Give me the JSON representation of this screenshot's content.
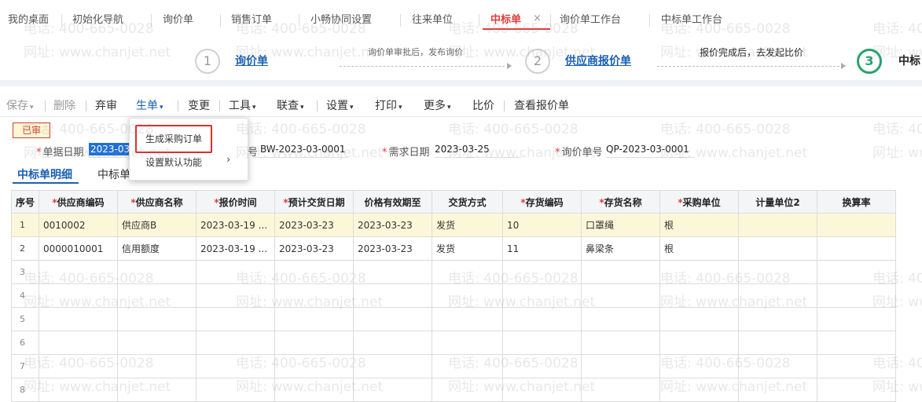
{
  "tabs": [
    {
      "label": "我的桌面"
    },
    {
      "label": "初始化导航"
    },
    {
      "label": "询价单"
    },
    {
      "label": "销售订单"
    },
    {
      "label": "小畅协同设置"
    },
    {
      "label": "往来单位"
    },
    {
      "label": "中标单"
    },
    {
      "label": "询价单工作台"
    },
    {
      "label": "中标单工作台"
    }
  ],
  "tab_close": "×",
  "flow": {
    "step1_num": "1",
    "step1_label": "询价单",
    "note1": "询价单审批后，发布询价",
    "step2_num": "2",
    "step2_label": "供应商报价单",
    "note2": "报价完成后，去发起比价",
    "step3_num": "3",
    "step3_label": "中标"
  },
  "toolbar": {
    "save": "保存",
    "delete": "删除",
    "unaudit": "弃审",
    "generate": "生单",
    "change": "变更",
    "tools": "工具",
    "query": "联查",
    "settings": "设置",
    "print": "打印",
    "more": "更多",
    "compare": "比价",
    "view_quote": "查看报价单",
    "caret": "▾"
  },
  "dropdown": {
    "item1": "生成采购订单",
    "item2": "设置默认功能",
    "arrow": "›"
  },
  "form": {
    "status_badge": "已审",
    "doc_date_label": "单据日期",
    "doc_date_value": "2023-03-",
    "doc_no_label": "号",
    "doc_no_value": "BW-2023-03-0001",
    "req_date_label": "需求日期",
    "req_date_value": "2023-03-25",
    "inquiry_no_label": "询价单号",
    "inquiry_no_value": "QP-2023-03-0001",
    "required_mark": "*"
  },
  "detail_tabs": {
    "tab1": "中标单明细",
    "tab2": "中标单"
  },
  "table": {
    "columns": [
      {
        "label": "序号",
        "req": ""
      },
      {
        "label": "供应商编码",
        "req": "*"
      },
      {
        "label": "供应商名称",
        "req": "*"
      },
      {
        "label": "报价时间",
        "req": "*"
      },
      {
        "label": "预计交货日期",
        "req": "*"
      },
      {
        "label": "价格有效期至",
        "req": ""
      },
      {
        "label": "交货方式",
        "req": ""
      },
      {
        "label": "存货编码",
        "req": "*"
      },
      {
        "label": "存货名称",
        "req": "*"
      },
      {
        "label": "采购单位",
        "req": "*"
      },
      {
        "label": "计量单位2",
        "req": ""
      },
      {
        "label": "换算率",
        "req": ""
      }
    ],
    "rows": [
      [
        "1",
        "0010002",
        "供应商B",
        "2023-03-19 ...",
        "2023-03-23",
        "2023-03-23",
        "发货",
        "10",
        "口罩绳",
        "根",
        "",
        ""
      ],
      [
        "2",
        "0000010001",
        "信用额度",
        "2023-03-19 ...",
        "2023-03-23",
        "2023-03-23",
        "发货",
        "11",
        "鼻梁条",
        "根",
        "",
        ""
      ],
      [
        "3",
        "",
        "",
        "",
        "",
        "",
        "",
        "",
        "",
        "",
        "",
        ""
      ],
      [
        "4",
        "",
        "",
        "",
        "",
        "",
        "",
        "",
        "",
        "",
        "",
        ""
      ],
      [
        "5",
        "",
        "",
        "",
        "",
        "",
        "",
        "",
        "",
        "",
        "",
        ""
      ],
      [
        "6",
        "",
        "",
        "",
        "",
        "",
        "",
        "",
        "",
        "",
        "",
        ""
      ],
      [
        "7",
        "",
        "",
        "",
        "",
        "",
        "",
        "",
        "",
        "",
        "",
        ""
      ],
      [
        "8",
        "",
        "",
        "",
        "",
        "",
        "",
        "",
        "",
        "",
        "",
        ""
      ]
    ]
  },
  "watermark": {
    "phone": "电话: 400-665-0028",
    "site": "网址: www.chanjet.net"
  }
}
